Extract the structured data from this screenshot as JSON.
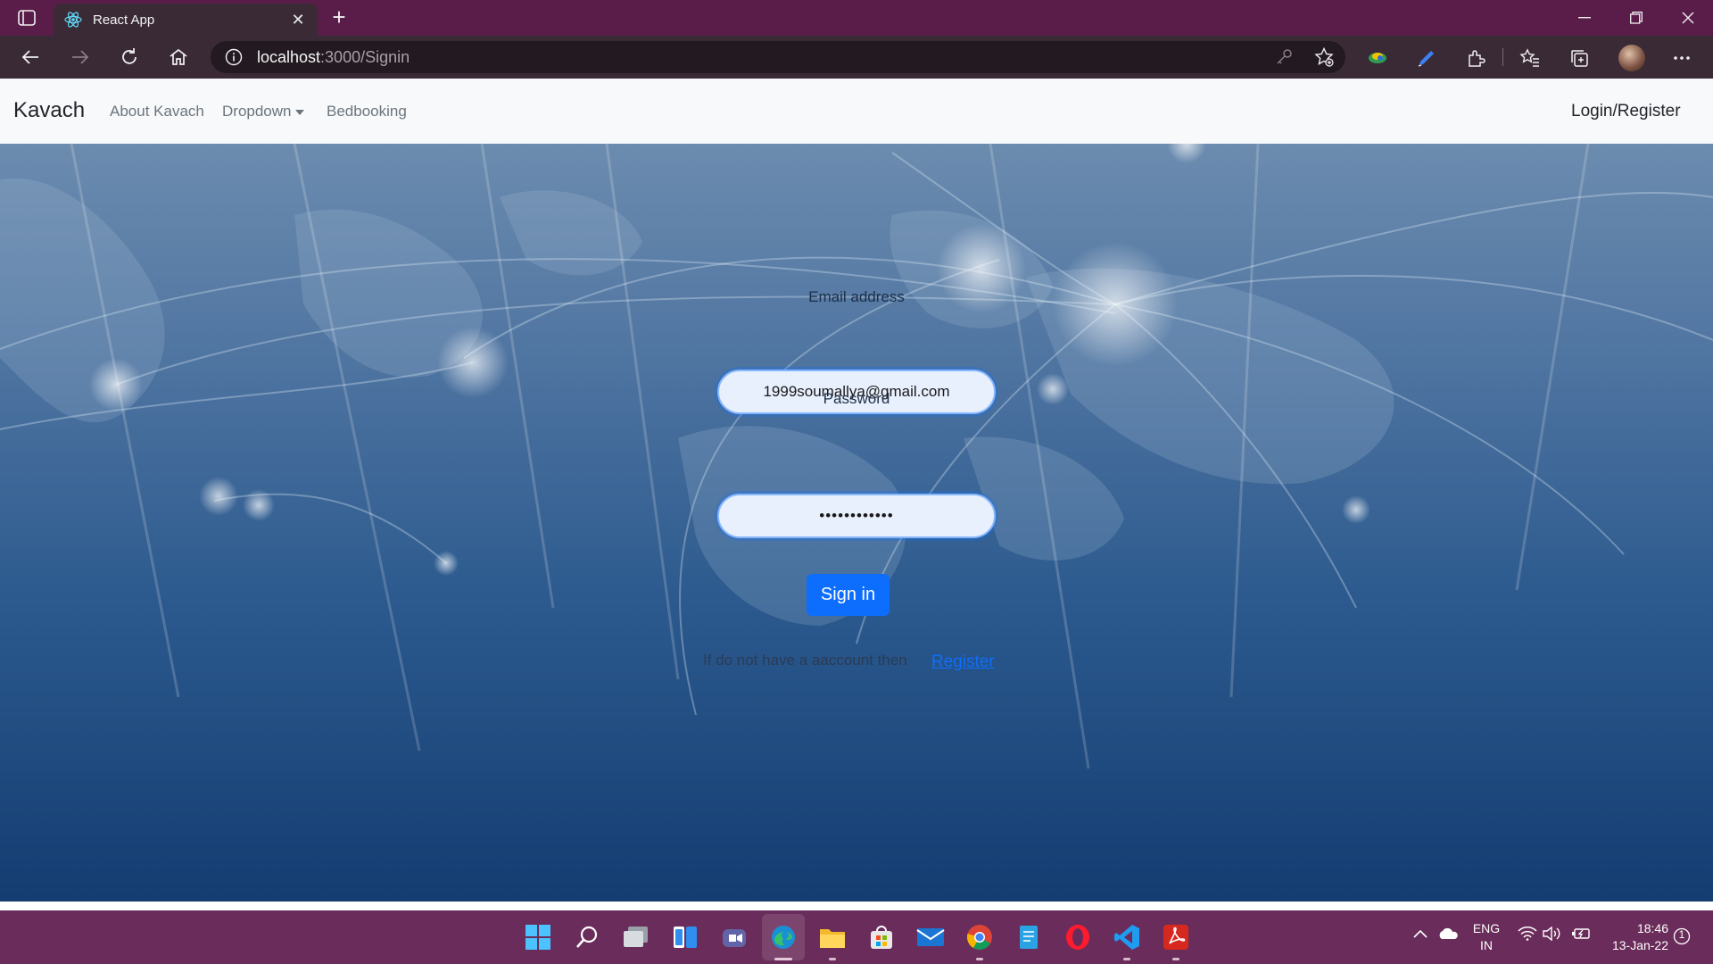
{
  "browser": {
    "tab_title": "React App",
    "url_host": "localhost",
    "url_path": ":3000/Signin"
  },
  "navbar": {
    "brand": "Kavach",
    "links": [
      "About Kavach",
      "Dropdown",
      "Bedbooking"
    ],
    "login": "Login/Register"
  },
  "form": {
    "email_label": "Email address",
    "email_value": "1999soumallya@gmail.com",
    "password_label": "Password",
    "password_value": "••••••••••••",
    "submit": "Sign in",
    "register_prompt": "If do not have a aaccount then",
    "register_link": "Register"
  },
  "taskbar": {
    "apps": [
      "start-icon",
      "search-icon",
      "task-view-icon",
      "widgets-icon",
      "teams-chat-icon",
      "edge-icon",
      "file-explorer-icon",
      "store-icon",
      "mail-icon",
      "chrome-icon",
      "notepad-icon",
      "opera-icon",
      "vscode-icon",
      "acrobat-icon"
    ],
    "lang_top": "ENG",
    "lang_bottom": "IN",
    "time": "18:46",
    "date": "13-Jan-22",
    "notification_count": "1"
  },
  "colors": {
    "titlebar": "#5a1d4a",
    "addressbar": "#3a2a36",
    "taskbar": "#6a2c5a",
    "primary": "#0d6efd",
    "navbar_bg": "#f8f9fa"
  }
}
